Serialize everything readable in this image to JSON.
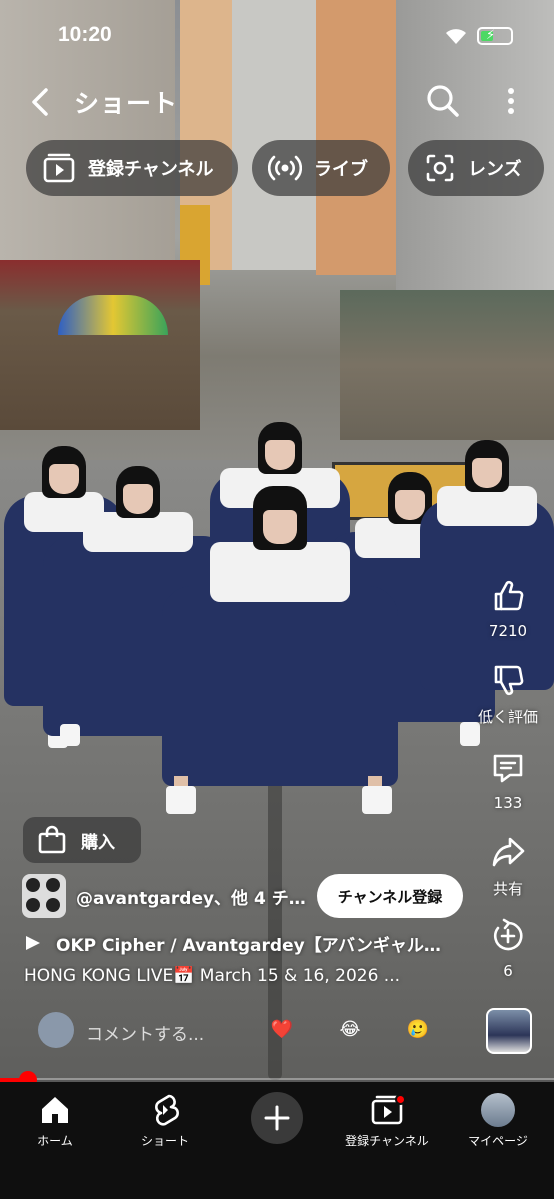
{
  "status_bar": {
    "time": "10:20"
  },
  "top_bar": {
    "title": "ショート"
  },
  "chips": [
    {
      "label": "登録チャンネル",
      "icon": "subscriptions-icon"
    },
    {
      "label": "ライブ",
      "icon": "live-icon"
    },
    {
      "label": "レンズ",
      "icon": "lens-icon"
    }
  ],
  "actions": {
    "like_count": "7210",
    "dislike_label": "低く評価",
    "comment_count": "133",
    "share_label": "共有",
    "remix_count": "6"
  },
  "buy": {
    "label": "購入"
  },
  "channel": {
    "name": "@avantgardey、他 4 チ…",
    "subscribe_label": "チャンネル登録"
  },
  "song": {
    "title": "OKP Cipher / Avantgardey【アバンギャル…"
  },
  "caption": {
    "text": "HONG KONG LIVE📅 March 15 & 16, 2026 ..."
  },
  "comment": {
    "placeholder": "コメントする..."
  },
  "reactions": [
    "❤️",
    "😂",
    "🥲"
  ],
  "playback": {
    "progress_percent": 5
  },
  "nav": [
    {
      "label": "ホーム",
      "icon": "home-icon"
    },
    {
      "label": "ショート",
      "icon": "shorts-icon"
    },
    {
      "label": "",
      "icon": "create-icon"
    },
    {
      "label": "登録チャンネル",
      "icon": "subscriptions-icon"
    },
    {
      "label": "マイページ",
      "icon": "avatar"
    }
  ],
  "colors": {
    "accent": "#ff0000",
    "nav_bg": "#0f0f0f",
    "chip_bg": "#3c3c3c"
  }
}
